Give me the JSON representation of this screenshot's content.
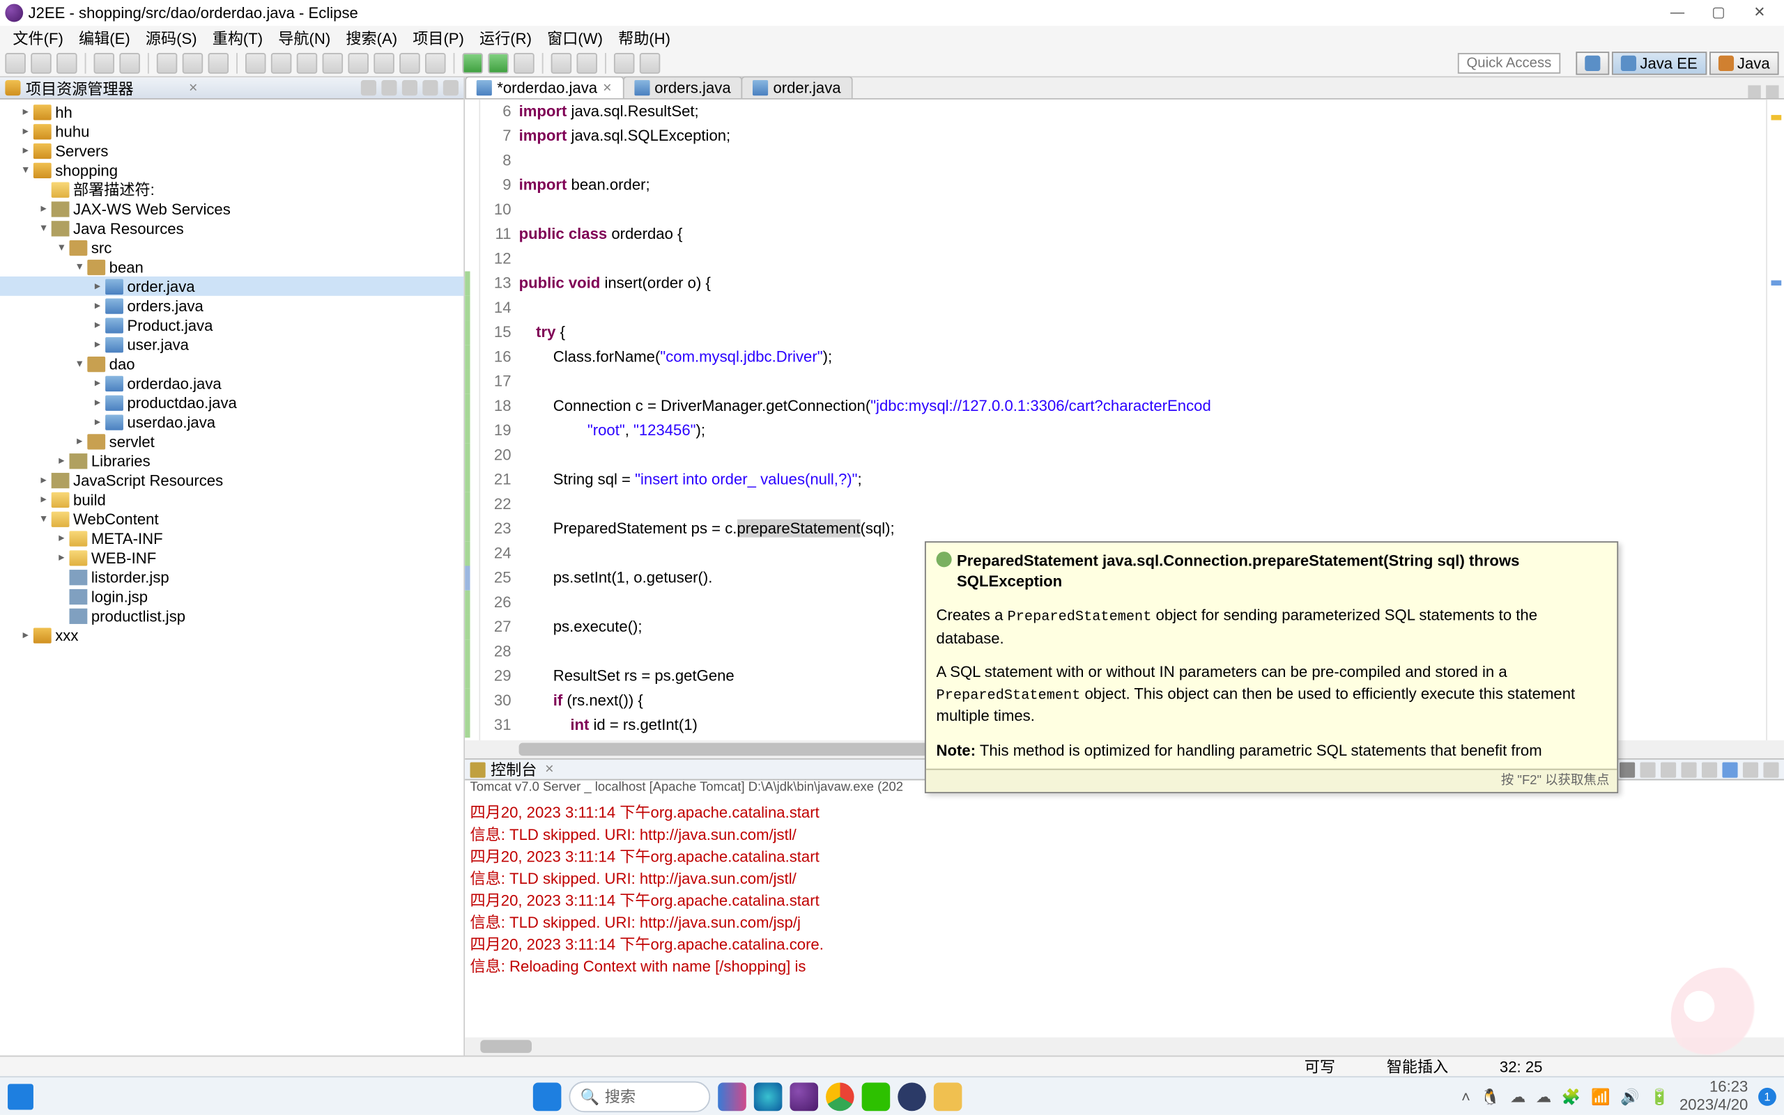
{
  "window": {
    "title": "J2EE - shopping/src/dao/orderdao.java - Eclipse",
    "min": "—",
    "max": "▢",
    "close": "✕"
  },
  "menu": [
    "文件(F)",
    "编辑(E)",
    "源码(S)",
    "重构(T)",
    "导航(N)",
    "搜索(A)",
    "项目(P)",
    "运行(R)",
    "窗口(W)",
    "帮助(H)"
  ],
  "quick_access": "Quick Access",
  "perspectives": {
    "javaee": "Java EE",
    "java": "Java"
  },
  "explorer": {
    "title": "项目资源管理器",
    "nodes": [
      {
        "ind": 1,
        "tw": "▸",
        "icn": "ficn-proj",
        "label": "hh"
      },
      {
        "ind": 1,
        "tw": "▸",
        "icn": "ficn-proj",
        "label": "huhu"
      },
      {
        "ind": 1,
        "tw": "▸",
        "icn": "ficn-proj",
        "label": "Servers"
      },
      {
        "ind": 1,
        "tw": "▾",
        "icn": "ficn-proj",
        "label": "shopping"
      },
      {
        "ind": 2,
        "tw": "",
        "icn": "ficn-fold",
        "label": "部署描述符:"
      },
      {
        "ind": 2,
        "tw": "▸",
        "icn": "ficn-lib",
        "label": "JAX-WS Web Services"
      },
      {
        "ind": 2,
        "tw": "▾",
        "icn": "ficn-lib",
        "label": "Java Resources"
      },
      {
        "ind": 3,
        "tw": "▾",
        "icn": "ficn-pkg",
        "label": "src"
      },
      {
        "ind": 4,
        "tw": "▾",
        "icn": "ficn-pkg",
        "label": "bean"
      },
      {
        "ind": 5,
        "tw": "▸",
        "icn": "ficn-java",
        "label": "order.java",
        "sel": true
      },
      {
        "ind": 5,
        "tw": "▸",
        "icn": "ficn-java",
        "label": "orders.java"
      },
      {
        "ind": 5,
        "tw": "▸",
        "icn": "ficn-java",
        "label": "Product.java"
      },
      {
        "ind": 5,
        "tw": "▸",
        "icn": "ficn-java",
        "label": "user.java"
      },
      {
        "ind": 4,
        "tw": "▾",
        "icn": "ficn-pkg",
        "label": "dao"
      },
      {
        "ind": 5,
        "tw": "▸",
        "icn": "ficn-java",
        "label": "orderdao.java"
      },
      {
        "ind": 5,
        "tw": "▸",
        "icn": "ficn-java",
        "label": "productdao.java"
      },
      {
        "ind": 5,
        "tw": "▸",
        "icn": "ficn-java",
        "label": "userdao.java"
      },
      {
        "ind": 4,
        "tw": "▸",
        "icn": "ficn-pkg",
        "label": "servlet"
      },
      {
        "ind": 3,
        "tw": "▸",
        "icn": "ficn-lib",
        "label": "Libraries"
      },
      {
        "ind": 2,
        "tw": "▸",
        "icn": "ficn-lib",
        "label": "JavaScript Resources"
      },
      {
        "ind": 2,
        "tw": "▸",
        "icn": "ficn-fold",
        "label": "build"
      },
      {
        "ind": 2,
        "tw": "▾",
        "icn": "ficn-fold",
        "label": "WebContent"
      },
      {
        "ind": 3,
        "tw": "▸",
        "icn": "ficn-fold",
        "label": "META-INF"
      },
      {
        "ind": 3,
        "tw": "▸",
        "icn": "ficn-fold",
        "label": "WEB-INF"
      },
      {
        "ind": 3,
        "tw": "",
        "icn": "ficn-jsp",
        "label": "listorder.jsp"
      },
      {
        "ind": 3,
        "tw": "",
        "icn": "ficn-jsp",
        "label": "login.jsp"
      },
      {
        "ind": 3,
        "tw": "",
        "icn": "ficn-jsp",
        "label": "productlist.jsp"
      },
      {
        "ind": 1,
        "tw": "▸",
        "icn": "ficn-proj",
        "label": "xxx"
      }
    ]
  },
  "editor": {
    "tabs": [
      {
        "label": "*orderdao.java",
        "dirty": true,
        "active": true
      },
      {
        "label": "orders.java"
      },
      {
        "label": "order.java"
      }
    ],
    "first_line": 6,
    "lines": [
      {
        "n": 6,
        "r": "",
        "html": "<span class='kw'>import</span> java.sql.ResultSet;"
      },
      {
        "n": 7,
        "r": "",
        "html": "<span class='kw'>import</span> java.sql.SQLException;"
      },
      {
        "n": 8,
        "r": "",
        "html": ""
      },
      {
        "n": 9,
        "r": "",
        "html": "<span class='kw'>import</span> bean.order;"
      },
      {
        "n": 10,
        "r": "",
        "html": ""
      },
      {
        "n": 11,
        "r": "",
        "html": "<span class='kw'>public class</span> orderdao {"
      },
      {
        "n": 12,
        "r": "",
        "html": ""
      },
      {
        "n": 13,
        "r": "g",
        "html": "<span class='kw'>public void</span> insert(order o) {"
      },
      {
        "n": 14,
        "r": "g",
        "html": ""
      },
      {
        "n": 15,
        "r": "g",
        "html": "    <span class='kw'>try</span> {"
      },
      {
        "n": 16,
        "r": "g",
        "html": "        Class.forName(<span class='str'>\"com.mysql.jdbc.Driver\"</span>);"
      },
      {
        "n": 17,
        "r": "g",
        "html": ""
      },
      {
        "n": 18,
        "r": "g",
        "html": "        Connection c = DriverManager.getConnection(<span class='str'>\"jdbc:mysql://127.0.0.1:3306/cart?characterEncod</span>"
      },
      {
        "n": 19,
        "r": "g",
        "html": "                <span class='str'>\"root\"</span>, <span class='str'>\"123456\"</span>);"
      },
      {
        "n": 20,
        "r": "g",
        "html": ""
      },
      {
        "n": 21,
        "r": "g",
        "html": "        String sql = <span class='str'>\"insert into order_ values(null,?)\"</span>;"
      },
      {
        "n": 22,
        "r": "g",
        "html": ""
      },
      {
        "n": 23,
        "r": "g",
        "html": "        PreparedStatement ps = c.<span class='hover-sel'>prepareStatement</span>(sql);"
      },
      {
        "n": 24,
        "r": "g",
        "html": ""
      },
      {
        "n": 25,
        "r": "b",
        "html": "        ps.setInt(1, o.getuser()."
      },
      {
        "n": 26,
        "r": "g",
        "html": ""
      },
      {
        "n": 27,
        "r": "g",
        "html": "        ps.execute();"
      },
      {
        "n": 28,
        "r": "g",
        "html": ""
      },
      {
        "n": 29,
        "r": "g",
        "html": "        ResultSet rs = ps.getGene"
      },
      {
        "n": 30,
        "r": "g",
        "html": "        <span class='kw'>if</span> (rs.next()) {"
      },
      {
        "n": 31,
        "r": "g",
        "html": "            <span class='kw'>int</span> id = rs.getInt(1)"
      }
    ]
  },
  "hover": {
    "sig": "PreparedStatement java.sql.Connection.prepareStatement(String sql) throws SQLException",
    "p1a": "Creates a ",
    "p1code": "PreparedStatement",
    "p1b": " object for sending parameterized SQL statements to the database.",
    "p2a": "A SQL statement with or without IN parameters can be pre-compiled and stored in a ",
    "p2code": "PreparedStatement",
    "p2b": " object. This object can then be used to efficiently execute this statement multiple times.",
    "p3a": "Note:",
    "p3b": " This method is optimized for handling parametric SQL statements that benefit from",
    "foot": "按 \"F2\" 以获取焦点"
  },
  "console": {
    "title": "控制台",
    "desc": "Tomcat v7.0 Server _ localhost [Apache Tomcat]  D:\\A\\jdk\\bin\\javaw.exe  (202",
    "lines": [
      {
        "c": "err",
        "t": "四月20, 2023 3:11:14 下午org.apache.catalina.start"
      },
      {
        "c": "err",
        "t": "信息: TLD skipped. URI: http://java.sun.com/jstl/"
      },
      {
        "c": "err",
        "t": "四月20, 2023 3:11:14 下午org.apache.catalina.start"
      },
      {
        "c": "err",
        "t": "信息: TLD skipped. URI: http://java.sun.com/jstl/"
      },
      {
        "c": "err",
        "t": "四月20, 2023 3:11:14 下午org.apache.catalina.start"
      },
      {
        "c": "err",
        "t": "信息: TLD skipped. URI: http://java.sun.com/jsp/j"
      },
      {
        "c": "err",
        "t": "四月20, 2023 3:11:14 下午org.apache.catalina.core."
      },
      {
        "c": "err",
        "t": "信息: Reloading Context with name [/shopping] is "
      }
    ]
  },
  "status": {
    "writable": "可写",
    "insert": "智能插入",
    "pos": "32: 25"
  },
  "taskbar": {
    "search": "搜索",
    "time": "16:23",
    "date": "2023/4/20"
  }
}
